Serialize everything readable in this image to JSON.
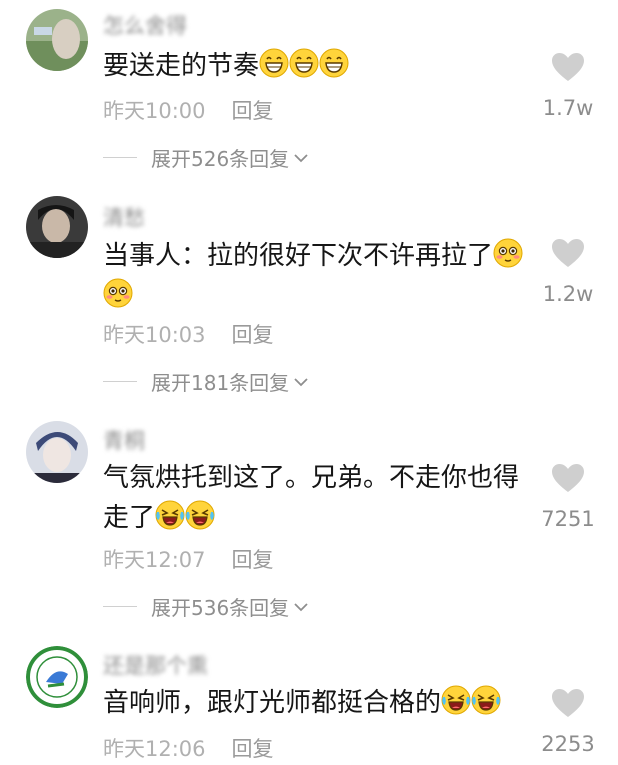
{
  "comments": [
    {
      "username": "怎么舍得",
      "text": "要送走的节奏",
      "time": "昨天10:00",
      "reply": "回复",
      "expand": "展开526条回复",
      "likes": "1.7w"
    },
    {
      "username": "清愁",
      "text": "当事人：拉的很好下次不许再拉了",
      "time": "昨天10:03",
      "reply": "回复",
      "expand": "展开181条回复",
      "likes": "1.2w"
    },
    {
      "username": "青桐",
      "text": "气氛烘托到这了。兄弟。不走你也得走了",
      "time": "昨天12:07",
      "reply": "回复",
      "expand": "展开536条回复",
      "likes": "7251"
    },
    {
      "username": "还是那个熏",
      "text": "音响师，跟灯光师都挺合格的",
      "time": "昨天12:06",
      "reply": "回复",
      "likes": "2253"
    }
  ],
  "icons": {
    "like": "heart-icon",
    "expand": "chevron-down-icon",
    "emoji_grin": "grinning-emoji",
    "emoji_flushed": "flushed-emoji",
    "emoji_laugh": "rolling-laughing-emoji"
  }
}
